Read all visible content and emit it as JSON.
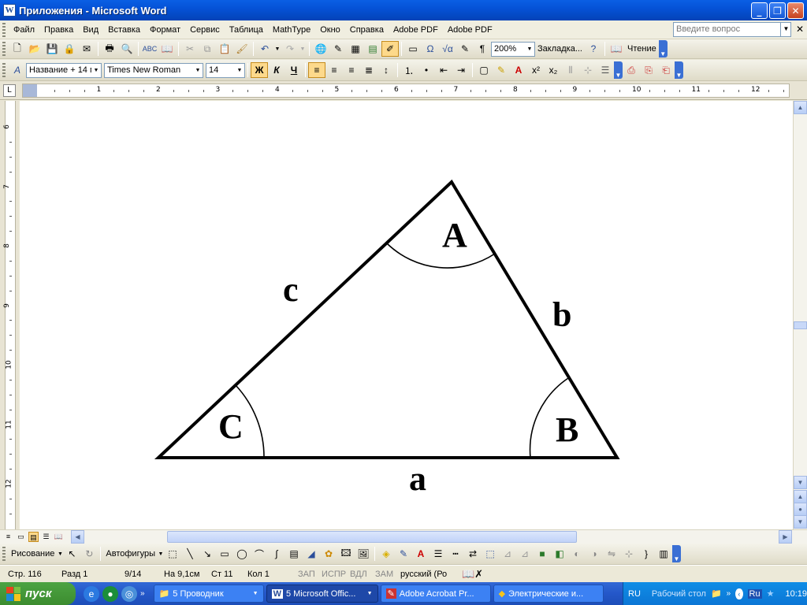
{
  "window": {
    "title": "Приложения - Microsoft Word",
    "app_icon": "W"
  },
  "menubar": {
    "items": [
      "Файл",
      "Правка",
      "Вид",
      "Вставка",
      "Формат",
      "Сервис",
      "Таблица",
      "MathType",
      "Окно",
      "Справка",
      "Adobe PDF",
      "Adobe PDF"
    ],
    "help_placeholder": "Введите вопрос"
  },
  "standard_toolbar": {
    "zoom": "200%",
    "bookmark": "Закладка...",
    "reading": "Чтение"
  },
  "formatting_toolbar": {
    "style": "Название + 14 г",
    "font": "Times New Roman",
    "size": "14",
    "bold": "Ж",
    "italic": "К",
    "underline": "Ч"
  },
  "ruler": {
    "h_numbers": [
      "1",
      "2",
      "3",
      "4",
      "5",
      "6",
      "7",
      "8",
      "9",
      "10",
      "11",
      "12"
    ],
    "v_numbers": [
      "6",
      "7",
      "8",
      "9",
      "10",
      "11",
      "12"
    ]
  },
  "document": {
    "vertex_labels": {
      "A": "A",
      "B": "B",
      "C": "C"
    },
    "side_labels": {
      "a": "a",
      "b": "b",
      "c": "c"
    }
  },
  "drawing_toolbar": {
    "draw": "Рисование",
    "autoshapes": "Автофигуры"
  },
  "statusbar": {
    "page": "Стр.  116",
    "section": "Разд  1",
    "pages": "9/14",
    "at": "На  9,1см",
    "line": "Ст  11",
    "col": "Кол  1",
    "rec": "ЗАП",
    "trk": "ИСПР",
    "ext": "ВДЛ",
    "ovr": "ЗАМ",
    "lang": "русский (Ро"
  },
  "taskbar": {
    "start": "пуск",
    "tasks": [
      "5 Проводник",
      "5 Microsoft Offic...",
      "Adobe Acrobat Pr...",
      "Электрические и..."
    ],
    "lang": "RU",
    "desktop": "Рабочий стол",
    "tray_lang": "Ru",
    "clock": "10:19"
  },
  "colors": {
    "title_blue": "#0552d7",
    "taskbar_blue": "#2457c9",
    "start_green": "#3c8c2f"
  }
}
